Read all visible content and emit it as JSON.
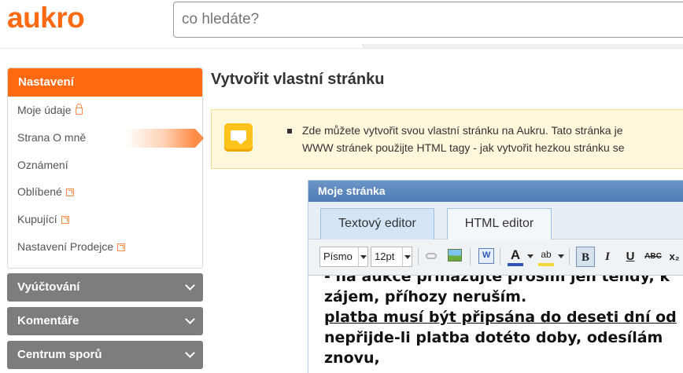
{
  "header": {
    "logo_text": "aukro",
    "search_placeholder": "co hledáte?"
  },
  "sidebar": {
    "section_title": "Nastavení",
    "items": [
      {
        "label": "Moje údaje",
        "icon": "lock-icon"
      },
      {
        "label": "Strana O mně",
        "active": true
      },
      {
        "label": "Oznámení"
      },
      {
        "label": "Oblíbené",
        "icon": "external-link-icon"
      },
      {
        "label": "Kupující",
        "icon": "external-link-icon"
      },
      {
        "label": "Nastavení Prodejce",
        "icon": "external-link-icon"
      }
    ],
    "accordions": [
      {
        "label": "Vyúčtování"
      },
      {
        "label": "Komentáře"
      },
      {
        "label": "Centrum sporů"
      }
    ]
  },
  "main": {
    "title": "Vytvořit vlastní stránku",
    "notice_lines": [
      "Zde můžete vytvořit svou vlastní stránku na Aukru. Tato stránka je",
      "WWW stránek použijte HTML tagy - jak vytvořit hezkou stránku se"
    ]
  },
  "editor": {
    "title": "Moje stránka",
    "tabs": [
      "Textový editor",
      "HTML editor"
    ],
    "font_select": "Písmo",
    "size_select": "12pt",
    "bold_label": "B",
    "italic_label": "I",
    "underline_label": "U",
    "strike_label": "ABC",
    "sub_label": "x₂",
    "fontcolor_label": "A",
    "highlight_label": "ab",
    "content_lines": [
      "- na aukce přihazujte prosím jen tehdy, k",
      "zájem, příhozy neruším.",
      "platba musí být připsána do deseti dní od",
      "nepřijde-li platba dotéto doby, odesílám",
      "znovu,"
    ]
  },
  "colors": {
    "brand_orange": "#ff6a13",
    "accordion_gray": "#7d7d7d",
    "editor_header_blue": "#5a86bd",
    "notice_bg": "#fff8dc"
  }
}
